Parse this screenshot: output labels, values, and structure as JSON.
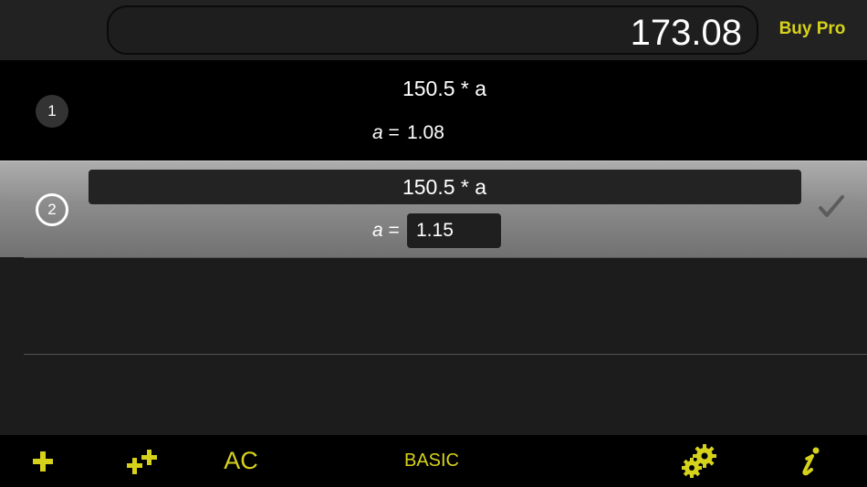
{
  "header": {
    "display_value": "173.08",
    "buy_pro_label": "Buy Pro"
  },
  "rows": [
    {
      "number": "1",
      "expression": "150.5 * a",
      "variable": "a",
      "equals": "=",
      "value": "1.08",
      "selected": false
    },
    {
      "number": "2",
      "expression": "150.5 * a",
      "variable": "a",
      "equals": "=",
      "value": "1.15",
      "selected": true
    }
  ],
  "toolbar": {
    "add_icon": "plus-icon",
    "add_multiple_icon": "double-plus-icon",
    "clear_label": "AC",
    "mode_label": "BASIC",
    "settings_icon": "gears-icon",
    "info_icon": "info-icon"
  },
  "colors": {
    "accent": "#d6d21c",
    "selected_row": "#8c8c8c",
    "background": "#1c1c1c"
  }
}
